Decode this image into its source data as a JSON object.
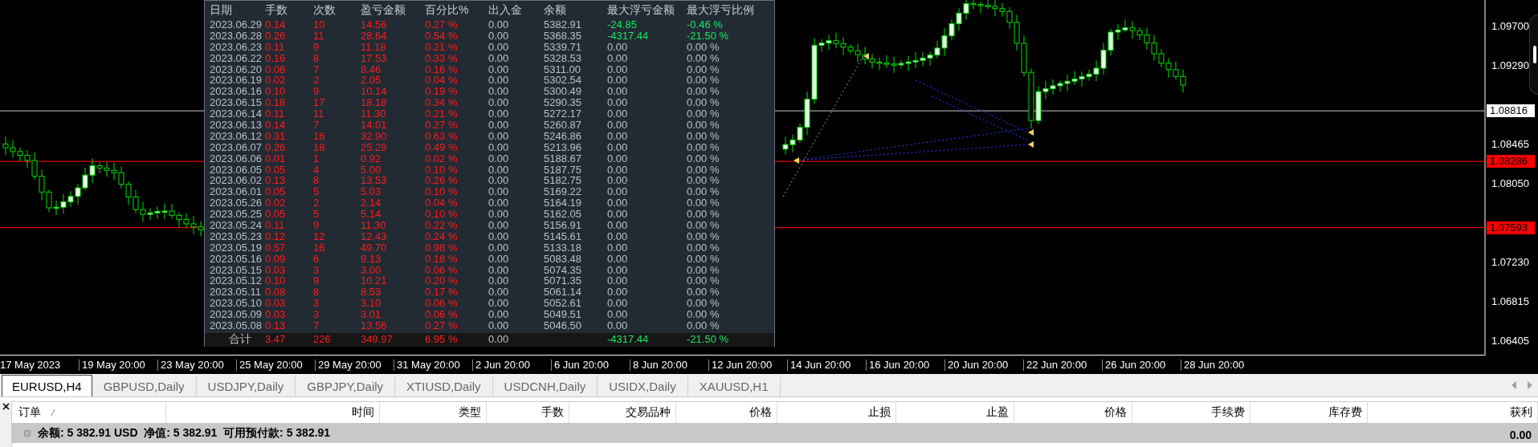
{
  "chart": {
    "price_axis": [
      "1.09700",
      "1.09290",
      "1.08465",
      "1.08050",
      "1.07230",
      "1.06815",
      "1.06405"
    ],
    "price_lines": [
      {
        "price": "1.08816",
        "kind": "current"
      },
      {
        "price": "1.08286",
        "kind": "level"
      },
      {
        "price": "1.07593",
        "kind": "level"
      }
    ],
    "time_axis": [
      "17 May 2023",
      "19 May 20:00",
      "23 May 20:00",
      "25 May 20:00",
      "29 May 20:00",
      "31 May 20:00",
      "2 Jun 20:00",
      "6 Jun 20:00",
      "8 Jun 20:00",
      "12 Jun 20:00",
      "14 Jun 20:00",
      "16 Jun 20:00",
      "20 Jun 20:00",
      "22 Jun 20:00",
      "26 Jun 20:00",
      "28 Jun 20:00"
    ]
  },
  "report": {
    "columns": [
      "日期",
      "手数",
      "次数",
      "盈亏金额",
      "百分比%",
      "出入金",
      "余额",
      "最大浮亏金额",
      "最大浮亏比例"
    ],
    "rows": [
      {
        "date": "2023.06.29",
        "lots": "0.14",
        "trades": "10",
        "pl": "14.56",
        "pct": "0.27 %",
        "in_out": "0.00",
        "balance": "5382.91",
        "max_float": "-24.85",
        "max_float_pct": "-0.46 %",
        "float_hit": true
      },
      {
        "date": "2023.06.28",
        "lots": "0.26",
        "trades": "11",
        "pl": "28.64",
        "pct": "0.54 %",
        "in_out": "0.00",
        "balance": "5368.35",
        "max_float": "-4317.44",
        "max_float_pct": "-21.50 %",
        "float_hit": true
      },
      {
        "date": "2023.06.23",
        "lots": "0.11",
        "trades": "9",
        "pl": "11.18",
        "pct": "0.21 %",
        "in_out": "0.00",
        "balance": "5339.71",
        "max_float": "0.00",
        "max_float_pct": "0.00 %",
        "float_hit": false
      },
      {
        "date": "2023.06.22",
        "lots": "0.16",
        "trades": "8",
        "pl": "17.53",
        "pct": "0.33 %",
        "in_out": "0.00",
        "balance": "5328.53",
        "max_float": "0.00",
        "max_float_pct": "0.00 %",
        "float_hit": false
      },
      {
        "date": "2023.06.20",
        "lots": "0.08",
        "trades": "7",
        "pl": "8.46",
        "pct": "0.16 %",
        "in_out": "0.00",
        "balance": "5311.00",
        "max_float": "0.00",
        "max_float_pct": "0.00 %",
        "float_hit": false
      },
      {
        "date": "2023.06.19",
        "lots": "0.02",
        "trades": "2",
        "pl": "2.05",
        "pct": "0.04 %",
        "in_out": "0.00",
        "balance": "5302.54",
        "max_float": "0.00",
        "max_float_pct": "0.00 %",
        "float_hit": false
      },
      {
        "date": "2023.06.16",
        "lots": "0.10",
        "trades": "9",
        "pl": "10.14",
        "pct": "0.19 %",
        "in_out": "0.00",
        "balance": "5300.49",
        "max_float": "0.00",
        "max_float_pct": "0.00 %",
        "float_hit": false
      },
      {
        "date": "2023.06.15",
        "lots": "0.18",
        "trades": "17",
        "pl": "18.18",
        "pct": "0.34 %",
        "in_out": "0.00",
        "balance": "5290.35",
        "max_float": "0.00",
        "max_float_pct": "0.00 %",
        "float_hit": false
      },
      {
        "date": "2023.06.14",
        "lots": "0.11",
        "trades": "11",
        "pl": "11.30",
        "pct": "0.21 %",
        "in_out": "0.00",
        "balance": "5272.17",
        "max_float": "0.00",
        "max_float_pct": "0.00 %",
        "float_hit": false
      },
      {
        "date": "2023.06.13",
        "lots": "0.14",
        "trades": "7",
        "pl": "14.01",
        "pct": "0.27 %",
        "in_out": "0.00",
        "balance": "5260.87",
        "max_float": "0.00",
        "max_float_pct": "0.00 %",
        "float_hit": false
      },
      {
        "date": "2023.06.12",
        "lots": "0.31",
        "trades": "16",
        "pl": "32.90",
        "pct": "0.63 %",
        "in_out": "0.00",
        "balance": "5246.86",
        "max_float": "0.00",
        "max_float_pct": "0.00 %",
        "float_hit": false
      },
      {
        "date": "2023.06.07",
        "lots": "0.26",
        "trades": "18",
        "pl": "25.29",
        "pct": "0.49 %",
        "in_out": "0.00",
        "balance": "5213.96",
        "max_float": "0.00",
        "max_float_pct": "0.00 %",
        "float_hit": false
      },
      {
        "date": "2023.06.06",
        "lots": "0.01",
        "trades": "1",
        "pl": "0.92",
        "pct": "0.02 %",
        "in_out": "0.00",
        "balance": "5188.67",
        "max_float": "0.00",
        "max_float_pct": "0.00 %",
        "float_hit": false
      },
      {
        "date": "2023.06.05",
        "lots": "0.05",
        "trades": "4",
        "pl": "5.00",
        "pct": "0.10 %",
        "in_out": "0.00",
        "balance": "5187.75",
        "max_float": "0.00",
        "max_float_pct": "0.00 %",
        "float_hit": false
      },
      {
        "date": "2023.06.02",
        "lots": "0.13",
        "trades": "8",
        "pl": "13.53",
        "pct": "0.26 %",
        "in_out": "0.00",
        "balance": "5182.75",
        "max_float": "0.00",
        "max_float_pct": "0.00 %",
        "float_hit": false
      },
      {
        "date": "2023.06.01",
        "lots": "0.05",
        "trades": "5",
        "pl": "5.03",
        "pct": "0.10 %",
        "in_out": "0.00",
        "balance": "5169.22",
        "max_float": "0.00",
        "max_float_pct": "0.00 %",
        "float_hit": false
      },
      {
        "date": "2023.05.26",
        "lots": "0.02",
        "trades": "2",
        "pl": "2.14",
        "pct": "0.04 %",
        "in_out": "0.00",
        "balance": "5164.19",
        "max_float": "0.00",
        "max_float_pct": "0.00 %",
        "float_hit": false
      },
      {
        "date": "2023.05.25",
        "lots": "0.05",
        "trades": "5",
        "pl": "5.14",
        "pct": "0.10 %",
        "in_out": "0.00",
        "balance": "5162.05",
        "max_float": "0.00",
        "max_float_pct": "0.00 %",
        "float_hit": false
      },
      {
        "date": "2023.05.24",
        "lots": "0.11",
        "trades": "9",
        "pl": "11.30",
        "pct": "0.22 %",
        "in_out": "0.00",
        "balance": "5156.91",
        "max_float": "0.00",
        "max_float_pct": "0.00 %",
        "float_hit": false
      },
      {
        "date": "2023.05.23",
        "lots": "0.12",
        "trades": "12",
        "pl": "12.43",
        "pct": "0.24 %",
        "in_out": "0.00",
        "balance": "5145.61",
        "max_float": "0.00",
        "max_float_pct": "0.00 %",
        "float_hit": false
      },
      {
        "date": "2023.05.19",
        "lots": "0.57",
        "trades": "16",
        "pl": "49.70",
        "pct": "0.98 %",
        "in_out": "0.00",
        "balance": "5133.18",
        "max_float": "0.00",
        "max_float_pct": "0.00 %",
        "float_hit": false
      },
      {
        "date": "2023.05.16",
        "lots": "0.09",
        "trades": "6",
        "pl": "9.13",
        "pct": "0.18 %",
        "in_out": "0.00",
        "balance": "5083.48",
        "max_float": "0.00",
        "max_float_pct": "0.00 %",
        "float_hit": false
      },
      {
        "date": "2023.05.15",
        "lots": "0.03",
        "trades": "3",
        "pl": "3.00",
        "pct": "0.06 %",
        "in_out": "0.00",
        "balance": "5074.35",
        "max_float": "0.00",
        "max_float_pct": "0.00 %",
        "float_hit": false
      },
      {
        "date": "2023.05.12",
        "lots": "0.10",
        "trades": "9",
        "pl": "10.21",
        "pct": "0.20 %",
        "in_out": "0.00",
        "balance": "5071.35",
        "max_float": "0.00",
        "max_float_pct": "0.00 %",
        "float_hit": false
      },
      {
        "date": "2023.05.11",
        "lots": "0.08",
        "trades": "8",
        "pl": "8.53",
        "pct": "0.17 %",
        "in_out": "0.00",
        "balance": "5061.14",
        "max_float": "0.00",
        "max_float_pct": "0.00 %",
        "float_hit": false
      },
      {
        "date": "2023.05.10",
        "lots": "0.03",
        "trades": "3",
        "pl": "3.10",
        "pct": "0.06 %",
        "in_out": "0.00",
        "balance": "5052.61",
        "max_float": "0.00",
        "max_float_pct": "0.00 %",
        "float_hit": false
      },
      {
        "date": "2023.05.09",
        "lots": "0.03",
        "trades": "3",
        "pl": "3.01",
        "pct": "0.06 %",
        "in_out": "0.00",
        "balance": "5049.51",
        "max_float": "0.00",
        "max_float_pct": "0.00 %",
        "float_hit": false
      },
      {
        "date": "2023.05.08",
        "lots": "0.13",
        "trades": "7",
        "pl": "13.56",
        "pct": "0.27 %",
        "in_out": "0.00",
        "balance": "5046.50",
        "max_float": "0.00",
        "max_float_pct": "0.00 %",
        "float_hit": false
      }
    ],
    "total": {
      "label": "合计",
      "lots": "3.47",
      "trades": "226",
      "pl": "349.97",
      "pct": "6.95 %",
      "in_out": "0.00",
      "max_float": "-4317.44",
      "max_float_pct": "-21.50 %"
    }
  },
  "chart_tabs": [
    {
      "label": "EURUSD,H4",
      "selected": true
    },
    {
      "label": "GBPUSD,Daily",
      "selected": false
    },
    {
      "label": "USDJPY,Daily",
      "selected": false
    },
    {
      "label": "GBPJPY,Daily",
      "selected": false
    },
    {
      "label": "XTIUSD,Daily",
      "selected": false
    },
    {
      "label": "USDCNH,Daily",
      "selected": false
    },
    {
      "label": "USIDX,Daily",
      "selected": false
    },
    {
      "label": "XAUUSD,H1",
      "selected": false
    }
  ],
  "terminal": {
    "columns": [
      "订单",
      "时间",
      "类型",
      "手数",
      "交易品种",
      "价格",
      "止损",
      "止盈",
      "价格",
      "手续费",
      "库存费",
      "获利"
    ],
    "summary": "余额: 5 382.91 USD  净值: 5 382.91  可用预付款: 5 382.91",
    "profit": "0.00"
  }
}
